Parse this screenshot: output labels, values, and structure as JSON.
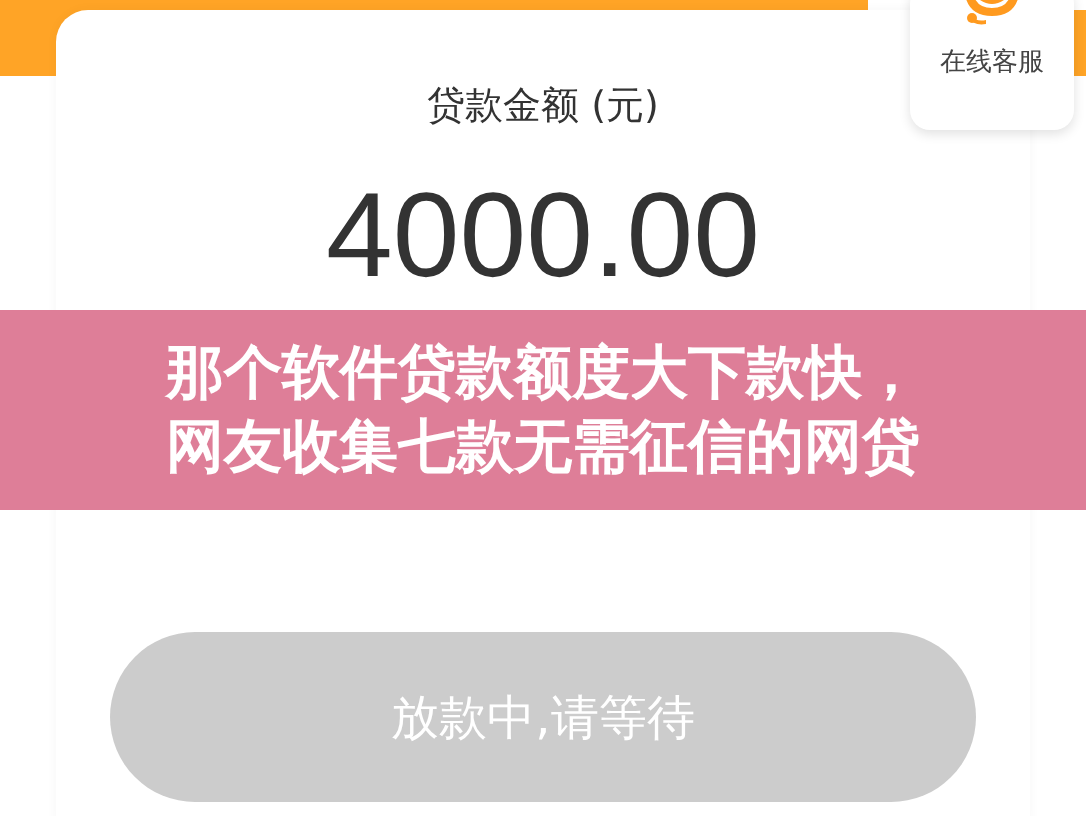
{
  "loan_card": {
    "label": "贷款金额 (元)",
    "amount": "4000.00",
    "button": {
      "label": "放款中,请等待",
      "disabled": true
    }
  },
  "support_widget": {
    "label": "在线客服"
  },
  "banner": {
    "lines": [
      "那个软件贷款额度大下款快，",
      "网友收集七款无需征信的网贷"
    ]
  }
}
